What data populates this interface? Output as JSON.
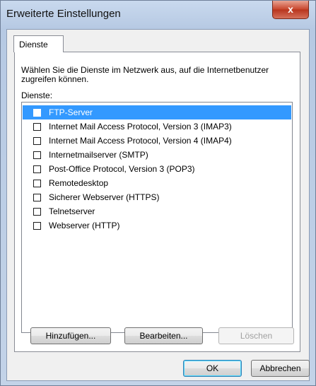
{
  "window": {
    "title": "Erweiterte Einstellungen",
    "close_label": "x"
  },
  "tabs": [
    {
      "label": "Dienste",
      "active": true
    }
  ],
  "panel": {
    "description": "Wählen Sie die Dienste im Netzwerk aus, auf die Internetbenutzer zugreifen können.",
    "list_label": "Dienste:"
  },
  "services": [
    {
      "label": "FTP-Server",
      "checked": false,
      "selected": true
    },
    {
      "label": "Internet Mail Access Protocol, Version 3 (IMAP3)",
      "checked": false,
      "selected": false
    },
    {
      "label": "Internet Mail Access Protocol, Version 4 (IMAP4)",
      "checked": false,
      "selected": false
    },
    {
      "label": "Internetmailserver (SMTP)",
      "checked": false,
      "selected": false
    },
    {
      "label": "Post-Office Protocol, Version 3 (POP3)",
      "checked": false,
      "selected": false
    },
    {
      "label": "Remotedesktop",
      "checked": false,
      "selected": false
    },
    {
      "label": "Sicherer Webserver (HTTPS)",
      "checked": false,
      "selected": false
    },
    {
      "label": "Telnetserver",
      "checked": false,
      "selected": false
    },
    {
      "label": "Webserver (HTTP)",
      "checked": false,
      "selected": false
    }
  ],
  "buttons": {
    "add": "Hinzufügen...",
    "edit": "Bearbeiten...",
    "delete": "Löschen",
    "ok": "OK",
    "cancel": "Abbrechen"
  },
  "colors": {
    "selection": "#3399ff",
    "close_button": "#c8442b"
  }
}
